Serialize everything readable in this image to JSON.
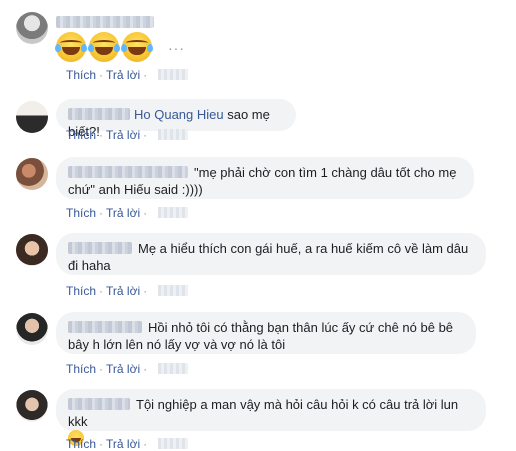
{
  "actions": {
    "like": "Thích",
    "reply": "Trả lời",
    "separator": "·"
  },
  "more_icon": "···",
  "comments": [
    {
      "mention": "",
      "text": "",
      "emojis": [
        "grinning-tears",
        "grinning-tears",
        "grinning-tears"
      ]
    },
    {
      "mention": "Ho Quang Hieu",
      "text": " sao mẹ biết?!"
    },
    {
      "mention": "",
      "text": "\"mẹ phải chờ con tìm 1 chàng dâu tốt cho mẹ chứ\" anh Hiếu said :))))"
    },
    {
      "mention": "",
      "text": "Mẹ a hiểu thích con gái huế, a ra huế kiếm cô về làm dâu đi haha"
    },
    {
      "mention": "",
      "text": "Hồi nhỏ tôi có thằng bạn thân lúc ấy cứ chê nó bê bê bây h lớn lên nó lấy vợ và vợ nó là tôi"
    },
    {
      "mention": "",
      "text": "Tội nghiệp a man vậy mà hỏi câu hỏi k có câu trả lời lun kkk",
      "emojis": [
        "grinning-tears"
      ]
    }
  ],
  "colors": {
    "bubble": "#f2f3f5",
    "link": "#385898",
    "meta": "#606770"
  }
}
